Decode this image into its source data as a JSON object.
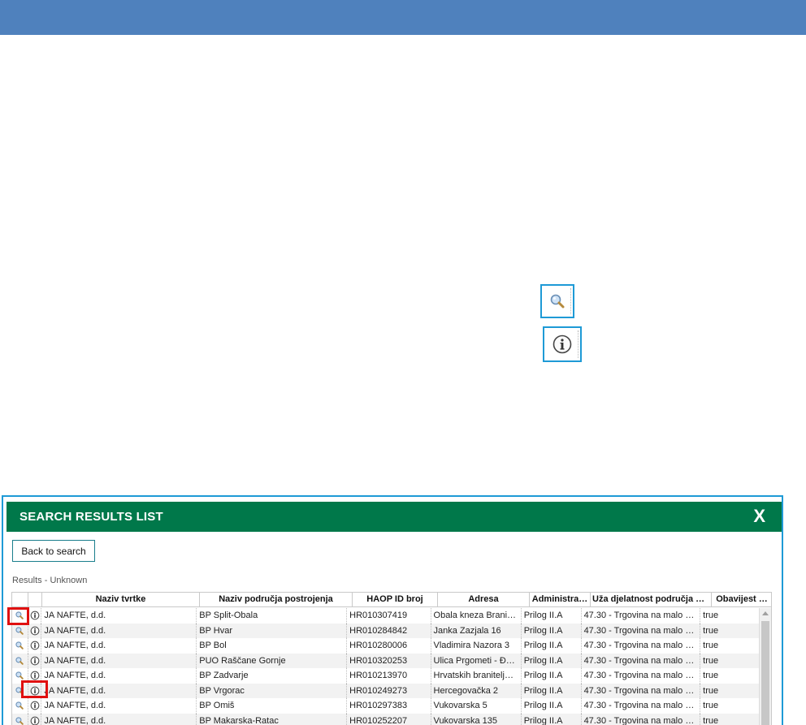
{
  "panel": {
    "title": "SEARCH RESULTS LIST",
    "close_label": "X",
    "back_button_label": "Back to search",
    "results_label": "Results - Unknown"
  },
  "icons": {
    "magnify": "magnifier-icon",
    "info": "info-icon"
  },
  "colors": {
    "top_bar": "#4f81bd",
    "panel_header": "#00784a",
    "highlight": "#e01010",
    "sample_border": "#1e9ad6"
  },
  "table": {
    "columns": [
      "Naziv tvrtke",
      "Naziv područja postrojenja",
      "HAOP ID broj",
      "Adresa",
      "Administra…",
      "Uža djelatnost područja p…",
      "Obavijest …"
    ],
    "rows": [
      [
        "JA NAFTE, d.d.",
        "BP Split-Obala",
        "HR010307419",
        "Obala kneza Branimi…",
        "Prilog II.A",
        "47.30 - Trgovina na malo mo…",
        "true"
      ],
      [
        "JA NAFTE, d.d.",
        "BP Hvar",
        "HR010284842",
        "Janka Zazjala 16",
        "Prilog II.A",
        "47.30 - Trgovina na malo mo…",
        "true"
      ],
      [
        "JA NAFTE, d.d.",
        "BP Bol",
        "HR010280006",
        "Vladimira Nazora 3",
        "Prilog II.A",
        "47.30 - Trgovina na malo mo…",
        "true"
      ],
      [
        "JA NAFTE, d.d.",
        "PUO Raščane Gornje",
        "HR010320253",
        "Ulica Prgometi - Đer…",
        "Prilog II.A",
        "47.30 - Trgovina na malo mo…",
        "true"
      ],
      [
        "JA NAFTE, d.d.",
        "BP Zadvarje",
        "HR010213970",
        "Hrvatskih branitelja …",
        "Prilog II.A",
        "47.30 - Trgovina na malo mo…",
        "true"
      ],
      [
        "JA NAFTE, d.d.",
        "BP Vrgorac",
        "HR010249273",
        "Hercegovačka 2",
        "Prilog II.A",
        "47.30 - Trgovina na malo mo…",
        "true"
      ],
      [
        "JA NAFTE, d.d.",
        "BP Omiš",
        "HR010297383",
        "Vukovarska 5",
        "Prilog II.A",
        "47.30 - Trgovina na malo mo…",
        "true"
      ],
      [
        "JA NAFTE, d.d.",
        "BP Makarska-Ratac",
        "HR010252207",
        "Vukovarska 135",
        "Prilog II.A",
        "47.30 - Trgovina na malo mo…",
        "true"
      ]
    ]
  }
}
